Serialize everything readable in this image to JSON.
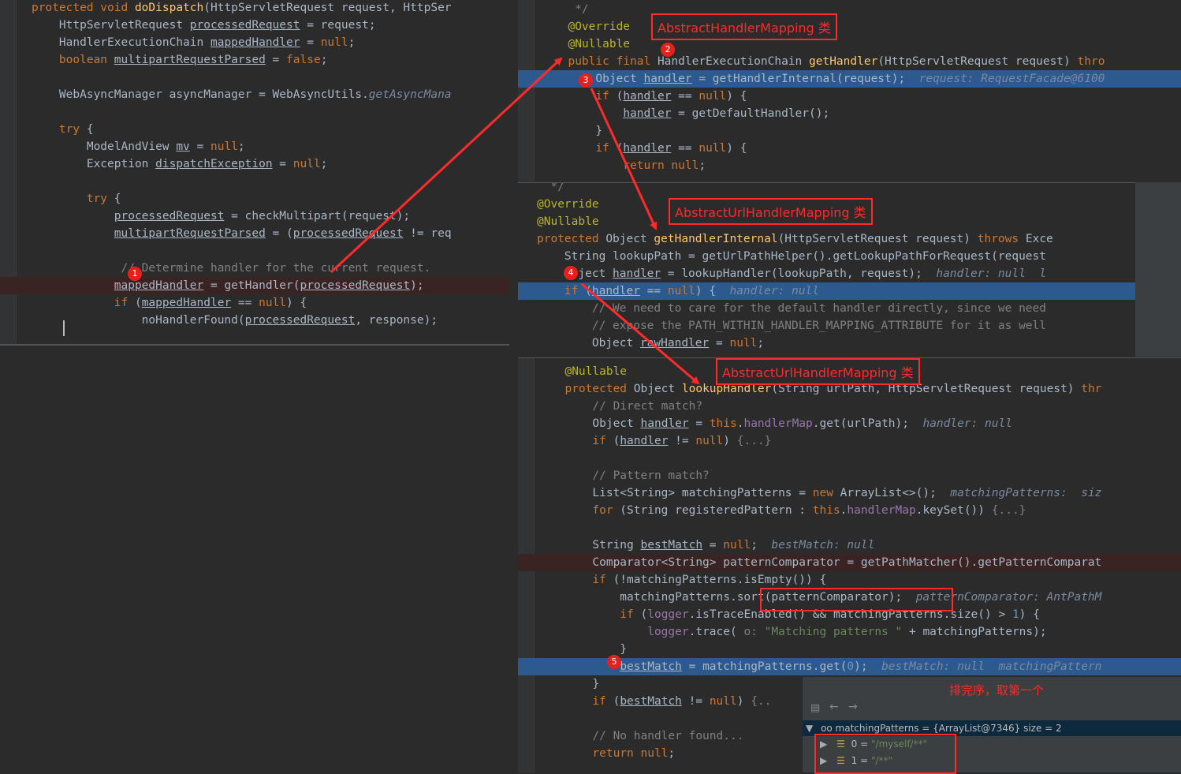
{
  "panel1": {
    "lines": [
      [
        {
          "t": "protected void ",
          "c": "kw"
        },
        {
          "t": "doDispatch",
          "c": "fn"
        },
        {
          "t": "(HttpServletRequest request, HttpSer"
        }
      ],
      [
        {
          "t": "    HttpServletRequest "
        },
        {
          "t": "processedRequest",
          "c": "ul"
        },
        {
          "t": " = request;"
        }
      ],
      [
        {
          "t": "    HandlerExecutionChain "
        },
        {
          "t": "mappedHandler",
          "c": "ul"
        },
        {
          "t": " = "
        },
        {
          "t": "null",
          "c": "kw"
        },
        {
          "t": ";"
        }
      ],
      [
        {
          "t": "    boolean ",
          "c": "kw"
        },
        {
          "t": "multipartRequestParsed",
          "c": "ul"
        },
        {
          "t": " = "
        },
        {
          "t": "false",
          "c": "kw"
        },
        {
          "t": ";"
        }
      ],
      [],
      [
        {
          "t": "    WebAsyncManager asyncManager = WebAsyncUtils."
        },
        {
          "t": "getAsyncMana",
          "c": "it"
        }
      ],
      [],
      [
        {
          "t": "    try",
          "c": "kw"
        },
        {
          "t": " {"
        }
      ],
      [
        {
          "t": "        ModelAndView "
        },
        {
          "t": "mv",
          "c": "ul"
        },
        {
          "t": " = "
        },
        {
          "t": "null",
          "c": "kw"
        },
        {
          "t": ";"
        }
      ],
      [
        {
          "t": "        Exception "
        },
        {
          "t": "dispatchException",
          "c": "ul"
        },
        {
          "t": " = "
        },
        {
          "t": "null",
          "c": "kw"
        },
        {
          "t": ";"
        }
      ],
      [],
      [
        {
          "t": "        try",
          "c": "kw"
        },
        {
          "t": " {"
        }
      ],
      [
        {
          "t": "            "
        },
        {
          "t": "processedRequest",
          "c": "ul"
        },
        {
          "t": " = checkMultipart(request);"
        }
      ],
      [
        {
          "t": "            "
        },
        {
          "t": "multipartRequestParsed",
          "c": "ul"
        },
        {
          "t": " = ("
        },
        {
          "t": "processedRequest",
          "c": "ul"
        },
        {
          "t": " != req"
        }
      ],
      [],
      [
        {
          "t": "             // Determine handler for the current request.",
          "c": "cm"
        }
      ],
      [
        {
          "t": "            "
        },
        {
          "t": "mappedHandler",
          "c": "ul"
        },
        {
          "t": " = getHandler("
        },
        {
          "t": "processedRequest",
          "c": "ul"
        },
        {
          "t": ");"
        }
      ],
      [
        {
          "t": "            if",
          "c": "kw"
        },
        {
          "t": " ("
        },
        {
          "t": "mappedHandler",
          "c": "ul"
        },
        {
          "t": " == "
        },
        {
          "t": "null",
          "c": "kw"
        },
        {
          "t": ") {"
        }
      ],
      [
        {
          "t": "                noHandlerFound("
        },
        {
          "t": "processedRequest",
          "c": "ul"
        },
        {
          "t": ", response);"
        }
      ]
    ]
  },
  "panel2": {
    "title": "AbstractHandlerMapping 类",
    "lines": [
      [
        {
          "t": "   */",
          "c": "cm"
        }
      ],
      [
        {
          "t": "  @Override",
          "c": "an"
        }
      ],
      [
        {
          "t": "  @Nullable",
          "c": "an"
        }
      ],
      [
        {
          "t": "  public final ",
          "c": "kw"
        },
        {
          "t": "HandlerExecutionChain "
        },
        {
          "t": "getHandler",
          "c": "fn"
        },
        {
          "t": "(HttpServletRequest request) "
        },
        {
          "t": "thro",
          "c": "kw"
        }
      ],
      [
        {
          "t": "      Object "
        },
        {
          "t": "handler",
          "c": "ul"
        },
        {
          "t": " = getHandlerInternal(request);  "
        },
        {
          "t": "request: RequestFacade@6100",
          "c": "it"
        }
      ],
      [
        {
          "t": "      if",
          "c": "kw"
        },
        {
          "t": " ("
        },
        {
          "t": "handler",
          "c": "ul"
        },
        {
          "t": " == "
        },
        {
          "t": "null",
          "c": "kw"
        },
        {
          "t": ") {"
        }
      ],
      [
        {
          "t": "          "
        },
        {
          "t": "handler",
          "c": "ul"
        },
        {
          "t": " = getDefaultHandler();"
        }
      ],
      [
        {
          "t": "      }"
        }
      ],
      [
        {
          "t": "      if",
          "c": "kw"
        },
        {
          "t": " ("
        },
        {
          "t": "handler",
          "c": "ul"
        },
        {
          "t": " == "
        },
        {
          "t": "null",
          "c": "kw"
        },
        {
          "t": ") {"
        }
      ],
      [
        {
          "t": "          return null",
          "c": "kw"
        },
        {
          "t": ";"
        }
      ]
    ]
  },
  "panel3": {
    "title": "AbstractUrlHandlerMapping 类",
    "lines": [
      [
        {
          "t": "  */",
          "c": "cm"
        }
      ],
      [
        {
          "t": "@Override",
          "c": "an"
        }
      ],
      [
        {
          "t": "@Nullable",
          "c": "an"
        }
      ],
      [
        {
          "t": "protected ",
          "c": "kw"
        },
        {
          "t": "Object "
        },
        {
          "t": "getHandlerInternal",
          "c": "fn"
        },
        {
          "t": "(HttpServletRequest request) "
        },
        {
          "t": "throws",
          "c": "kw"
        },
        {
          "t": " Exce"
        }
      ],
      [
        {
          "t": "    String lookupPath = getUrlPathHelper().getLookupPathForRequest(request"
        }
      ],
      [
        {
          "t": "    Object "
        },
        {
          "t": "handler",
          "c": "ul"
        },
        {
          "t": " = lookupHandler(lookupPath, request);  "
        },
        {
          "t": "handler: null  l",
          "c": "it"
        }
      ],
      [
        {
          "t": "    if",
          "c": "kw"
        },
        {
          "t": " ("
        },
        {
          "t": "handler",
          "c": "ul"
        },
        {
          "t": " == "
        },
        {
          "t": "null",
          "c": "kw"
        },
        {
          "t": ") {  "
        },
        {
          "t": "handler: null",
          "c": "it"
        }
      ],
      [
        {
          "t": "        // We need to care for the default handler directly, since we need",
          "c": "cm"
        }
      ],
      [
        {
          "t": "        // expose the PATH_WITHIN_HANDLER_MAPPING_ATTRIBUTE for it as well",
          "c": "cm"
        }
      ],
      [
        {
          "t": "        Object "
        },
        {
          "t": "rawHandler",
          "c": "ul"
        },
        {
          "t": " = "
        },
        {
          "t": "null",
          "c": "kw"
        },
        {
          "t": ";"
        }
      ]
    ]
  },
  "panel4": {
    "title": "AbstractUrlHandlerMapping 类",
    "lines": [
      [
        {
          "t": "  @Nullable",
          "c": "an"
        }
      ],
      [
        {
          "t": "  protected ",
          "c": "kw"
        },
        {
          "t": "Object "
        },
        {
          "t": "lookupHandler",
          "c": "fn"
        },
        {
          "t": "(String urlPath, HttpServletRequest request) "
        },
        {
          "t": "thr",
          "c": "kw"
        }
      ],
      [
        {
          "t": "      // Direct match?",
          "c": "cm"
        }
      ],
      [
        {
          "t": "      Object "
        },
        {
          "t": "handler",
          "c": "ul"
        },
        {
          "t": " = "
        },
        {
          "t": "this",
          "c": "kw"
        },
        {
          "t": "."
        },
        {
          "t": "handlerMap",
          "c": "fld"
        },
        {
          "t": ".get(urlPath);  "
        },
        {
          "t": "handler: null",
          "c": "it"
        }
      ],
      [
        {
          "t": "      if",
          "c": "kw"
        },
        {
          "t": " ("
        },
        {
          "t": "handler",
          "c": "ul"
        },
        {
          "t": " != "
        },
        {
          "t": "null",
          "c": "kw"
        },
        {
          "t": ") "
        },
        {
          "t": "{...}",
          "c": "cm"
        }
      ],
      [],
      [
        {
          "t": "      // Pattern match?",
          "c": "cm"
        }
      ],
      [
        {
          "t": "      List<String> matchingPatterns = "
        },
        {
          "t": "new ",
          "c": "kw"
        },
        {
          "t": "ArrayList<>();  "
        },
        {
          "t": "matchingPatterns:  siz",
          "c": "it"
        }
      ],
      [
        {
          "t": "      for",
          "c": "kw"
        },
        {
          "t": " (String registeredPattern : "
        },
        {
          "t": "this",
          "c": "kw"
        },
        {
          "t": "."
        },
        {
          "t": "handlerMap",
          "c": "fld"
        },
        {
          "t": ".keySet()) "
        },
        {
          "t": "{...}",
          "c": "cm"
        }
      ],
      [],
      [
        {
          "t": "      String "
        },
        {
          "t": "bestMatch",
          "c": "ul"
        },
        {
          "t": " = "
        },
        {
          "t": "null",
          "c": "kw"
        },
        {
          "t": ";  "
        },
        {
          "t": "bestMatch: null",
          "c": "it"
        }
      ],
      [
        {
          "t": "      Comparator<String> patternComparator = getPathMatcher().getPatternComparat"
        }
      ],
      [
        {
          "t": "      if",
          "c": "kw"
        },
        {
          "t": " (!matchingPatterns.isEmpty()) {"
        }
      ],
      [
        {
          "t": "          matchingPatterns.sort(patternComparator);  "
        },
        {
          "t": "patternComparator: AntPathM",
          "c": "it"
        }
      ],
      [
        {
          "t": "          if",
          "c": "kw"
        },
        {
          "t": " ("
        },
        {
          "t": "logger",
          "c": "fld"
        },
        {
          "t": ".isTraceEnabled() && matchingPatterns.size() > "
        },
        {
          "t": "1",
          "c": "num"
        },
        {
          "t": ") {"
        }
      ],
      [
        {
          "t": "              "
        },
        {
          "t": "logger",
          "c": "fld"
        },
        {
          "t": ".trace( "
        },
        {
          "t": "o: ",
          "c": "cm"
        },
        {
          "t": "\"Matching patterns \"",
          "c": "str"
        },
        {
          "t": " + matchingPatterns);"
        }
      ],
      [
        {
          "t": "          }"
        }
      ],
      [
        {
          "t": "          "
        },
        {
          "t": "bestMatch",
          "c": "ul"
        },
        {
          "t": " = matchingPatterns.get("
        },
        {
          "t": "0",
          "c": "num"
        },
        {
          "t": ");  "
        },
        {
          "t": "bestMatch: null  matchingPattern",
          "c": "it"
        }
      ],
      [
        {
          "t": "      }"
        }
      ],
      [
        {
          "t": "      if",
          "c": "kw"
        },
        {
          "t": " ("
        },
        {
          "t": "bestMatch",
          "c": "ul"
        },
        {
          "t": " != "
        },
        {
          "t": "null",
          "c": "kw"
        },
        {
          "t": ") "
        },
        {
          "t": "{..",
          "c": "cm"
        }
      ],
      [],
      [
        {
          "t": "      // No handler found...",
          "c": "cm"
        }
      ],
      [
        {
          "t": "      return null",
          "c": "kw"
        },
        {
          "t": ";"
        }
      ]
    ]
  },
  "badges": [
    "1",
    "2",
    "3",
    "4",
    "5"
  ],
  "note": "排完序，取第一个",
  "debugger": {
    "var_line": "oo matchingPatterns = {ArrayList@7346}  size = 2",
    "items": [
      {
        "index": "0",
        "value": "\"/myself/**\""
      },
      {
        "index": "1",
        "value": "\"/**\""
      }
    ]
  },
  "colors": {
    "annotation_red": "#ff2a2a",
    "highlight_blue": "#2d5a8e",
    "editor_bg": "#2b2b2b"
  }
}
